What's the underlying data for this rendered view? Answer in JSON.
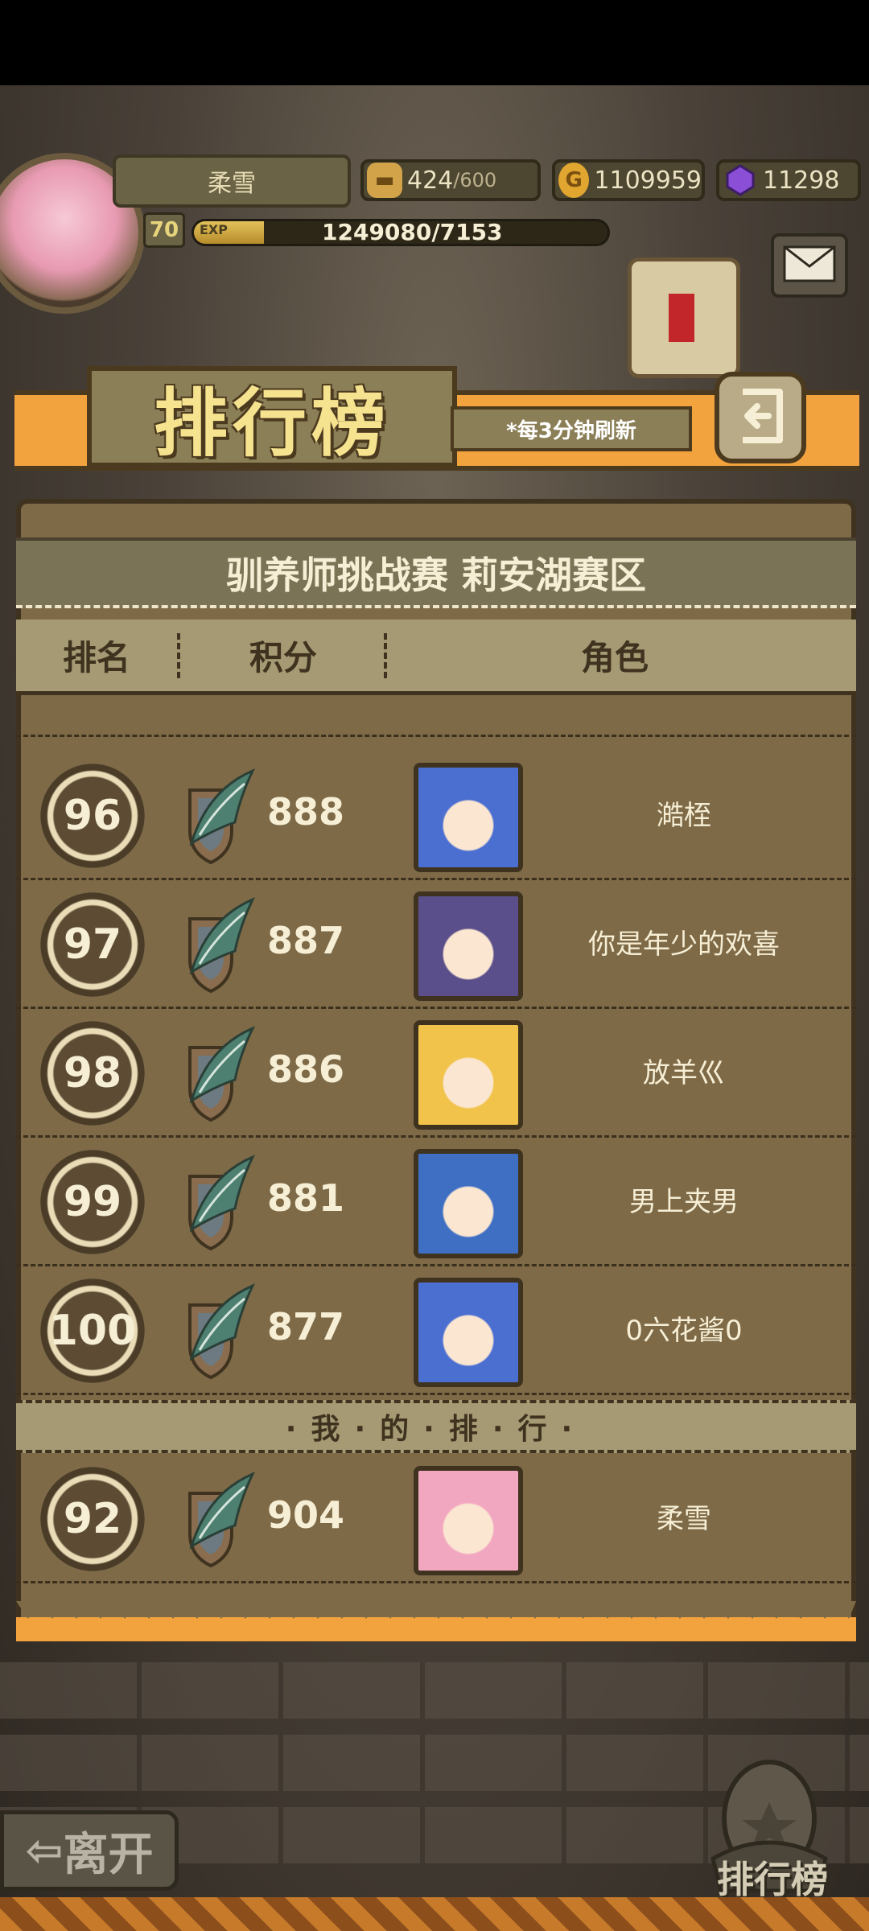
{
  "player": {
    "name": "柔雪",
    "level": "70",
    "exp_label": "EXP",
    "exp_text": "1249080/7153",
    "exp_progress": 0.17
  },
  "resources": {
    "stamina": "424",
    "stamina_max": "/600",
    "gold_symbol": "G",
    "gold": "1109959",
    "gems": "11298"
  },
  "banner": {
    "title": "排行榜",
    "refresh_note": "*每3分钟刷新"
  },
  "board": {
    "title": "驯养师挑战赛 莉安湖赛区",
    "columns": [
      "排名",
      "积分",
      "角色"
    ],
    "rows": [
      {
        "rank": "96",
        "score": "888",
        "name": "澔桎",
        "portrait_color": "#4b6fd0"
      },
      {
        "rank": "97",
        "score": "887",
        "name": "你是年少的欢喜",
        "portrait_color": "#5a4f8a"
      },
      {
        "rank": "98",
        "score": "886",
        "name": "放羊巛",
        "portrait_color": "#f1c34a"
      },
      {
        "rank": "99",
        "score": "881",
        "name": "男上夹男",
        "portrait_color": "#3e6fc2"
      },
      {
        "rank": "100",
        "score": "877",
        "name": "0六花酱0",
        "portrait_color": "#4b6fd0"
      }
    ],
    "my_rank_label": "·我·的·排·行·",
    "my_rank": {
      "rank": "92",
      "score": "904",
      "name": "柔雪",
      "portrait_color": "#f2a7c0"
    }
  },
  "bottom": {
    "leave_label": "离开",
    "ranking_label": "排行榜"
  },
  "colors": {
    "accent_orange": "#f3a33e",
    "board_brown": "#7e6a47",
    "text_cream": "#f6efd6"
  }
}
